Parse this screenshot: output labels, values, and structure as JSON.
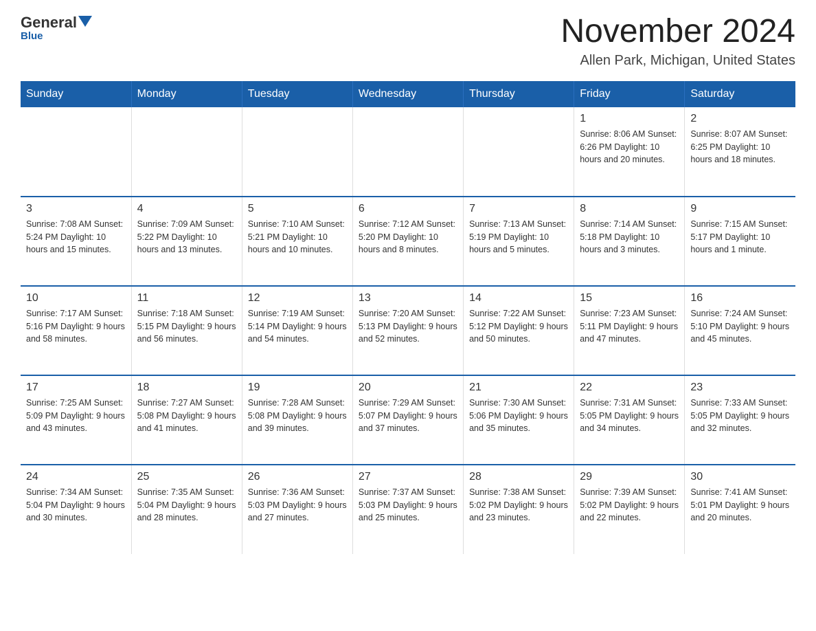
{
  "header": {
    "logo_general": "General",
    "logo_blue": "Blue",
    "title": "November 2024",
    "subtitle": "Allen Park, Michigan, United States"
  },
  "days_of_week": [
    "Sunday",
    "Monday",
    "Tuesday",
    "Wednesday",
    "Thursday",
    "Friday",
    "Saturday"
  ],
  "weeks": [
    [
      {
        "num": "",
        "info": ""
      },
      {
        "num": "",
        "info": ""
      },
      {
        "num": "",
        "info": ""
      },
      {
        "num": "",
        "info": ""
      },
      {
        "num": "",
        "info": ""
      },
      {
        "num": "1",
        "info": "Sunrise: 8:06 AM\nSunset: 6:26 PM\nDaylight: 10 hours\nand 20 minutes."
      },
      {
        "num": "2",
        "info": "Sunrise: 8:07 AM\nSunset: 6:25 PM\nDaylight: 10 hours\nand 18 minutes."
      }
    ],
    [
      {
        "num": "3",
        "info": "Sunrise: 7:08 AM\nSunset: 5:24 PM\nDaylight: 10 hours\nand 15 minutes."
      },
      {
        "num": "4",
        "info": "Sunrise: 7:09 AM\nSunset: 5:22 PM\nDaylight: 10 hours\nand 13 minutes."
      },
      {
        "num": "5",
        "info": "Sunrise: 7:10 AM\nSunset: 5:21 PM\nDaylight: 10 hours\nand 10 minutes."
      },
      {
        "num": "6",
        "info": "Sunrise: 7:12 AM\nSunset: 5:20 PM\nDaylight: 10 hours\nand 8 minutes."
      },
      {
        "num": "7",
        "info": "Sunrise: 7:13 AM\nSunset: 5:19 PM\nDaylight: 10 hours\nand 5 minutes."
      },
      {
        "num": "8",
        "info": "Sunrise: 7:14 AM\nSunset: 5:18 PM\nDaylight: 10 hours\nand 3 minutes."
      },
      {
        "num": "9",
        "info": "Sunrise: 7:15 AM\nSunset: 5:17 PM\nDaylight: 10 hours\nand 1 minute."
      }
    ],
    [
      {
        "num": "10",
        "info": "Sunrise: 7:17 AM\nSunset: 5:16 PM\nDaylight: 9 hours\nand 58 minutes."
      },
      {
        "num": "11",
        "info": "Sunrise: 7:18 AM\nSunset: 5:15 PM\nDaylight: 9 hours\nand 56 minutes."
      },
      {
        "num": "12",
        "info": "Sunrise: 7:19 AM\nSunset: 5:14 PM\nDaylight: 9 hours\nand 54 minutes."
      },
      {
        "num": "13",
        "info": "Sunrise: 7:20 AM\nSunset: 5:13 PM\nDaylight: 9 hours\nand 52 minutes."
      },
      {
        "num": "14",
        "info": "Sunrise: 7:22 AM\nSunset: 5:12 PM\nDaylight: 9 hours\nand 50 minutes."
      },
      {
        "num": "15",
        "info": "Sunrise: 7:23 AM\nSunset: 5:11 PM\nDaylight: 9 hours\nand 47 minutes."
      },
      {
        "num": "16",
        "info": "Sunrise: 7:24 AM\nSunset: 5:10 PM\nDaylight: 9 hours\nand 45 minutes."
      }
    ],
    [
      {
        "num": "17",
        "info": "Sunrise: 7:25 AM\nSunset: 5:09 PM\nDaylight: 9 hours\nand 43 minutes."
      },
      {
        "num": "18",
        "info": "Sunrise: 7:27 AM\nSunset: 5:08 PM\nDaylight: 9 hours\nand 41 minutes."
      },
      {
        "num": "19",
        "info": "Sunrise: 7:28 AM\nSunset: 5:08 PM\nDaylight: 9 hours\nand 39 minutes."
      },
      {
        "num": "20",
        "info": "Sunrise: 7:29 AM\nSunset: 5:07 PM\nDaylight: 9 hours\nand 37 minutes."
      },
      {
        "num": "21",
        "info": "Sunrise: 7:30 AM\nSunset: 5:06 PM\nDaylight: 9 hours\nand 35 minutes."
      },
      {
        "num": "22",
        "info": "Sunrise: 7:31 AM\nSunset: 5:05 PM\nDaylight: 9 hours\nand 34 minutes."
      },
      {
        "num": "23",
        "info": "Sunrise: 7:33 AM\nSunset: 5:05 PM\nDaylight: 9 hours\nand 32 minutes."
      }
    ],
    [
      {
        "num": "24",
        "info": "Sunrise: 7:34 AM\nSunset: 5:04 PM\nDaylight: 9 hours\nand 30 minutes."
      },
      {
        "num": "25",
        "info": "Sunrise: 7:35 AM\nSunset: 5:04 PM\nDaylight: 9 hours\nand 28 minutes."
      },
      {
        "num": "26",
        "info": "Sunrise: 7:36 AM\nSunset: 5:03 PM\nDaylight: 9 hours\nand 27 minutes."
      },
      {
        "num": "27",
        "info": "Sunrise: 7:37 AM\nSunset: 5:03 PM\nDaylight: 9 hours\nand 25 minutes."
      },
      {
        "num": "28",
        "info": "Sunrise: 7:38 AM\nSunset: 5:02 PM\nDaylight: 9 hours\nand 23 minutes."
      },
      {
        "num": "29",
        "info": "Sunrise: 7:39 AM\nSunset: 5:02 PM\nDaylight: 9 hours\nand 22 minutes."
      },
      {
        "num": "30",
        "info": "Sunrise: 7:41 AM\nSunset: 5:01 PM\nDaylight: 9 hours\nand 20 minutes."
      }
    ]
  ]
}
